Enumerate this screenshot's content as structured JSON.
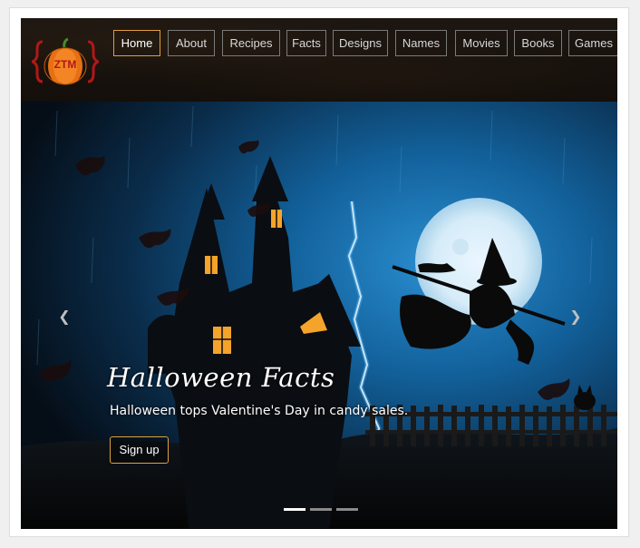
{
  "logo": {
    "text": "ZTM",
    "icon": "pumpkin-icon"
  },
  "nav": {
    "items": [
      "Home",
      "About",
      "Recipes",
      "Facts",
      "Designs",
      "Names",
      "Movies",
      "Books",
      "Games"
    ],
    "active": "Home"
  },
  "carousel": {
    "title": "Halloween Facts",
    "text": "Halloween tops Valentine's Day in candy sales.",
    "button_label": "Sign up",
    "prev_icon": "chevron-left-icon",
    "next_icon": "chevron-right-icon",
    "slide_count": 3,
    "active_slide": 1
  },
  "colors": {
    "accent": "#e0a040",
    "navbar_bg": "#1a1410",
    "pumpkin": "#f07a1a",
    "brackets": "#b01818"
  }
}
